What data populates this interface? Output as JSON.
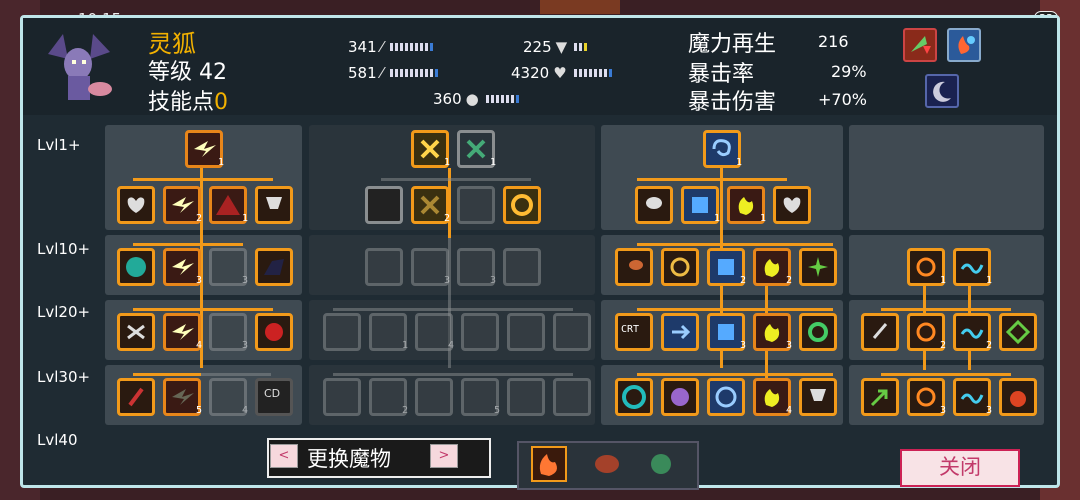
{
  "status": {
    "time": "10:15",
    "badge": "33"
  },
  "character": {
    "name": "灵狐",
    "level_label": "等级 42",
    "skill_points_label": "技能点",
    "skill_points_value": "0"
  },
  "stats": {
    "attack": "341",
    "magic": "581",
    "speed": "360",
    "defense": "225",
    "hp": "4320"
  },
  "regen": {
    "regen_label": "魔力再生",
    "regen_value": "216",
    "crit_rate_label": "暴击率",
    "crit_rate_value": "29%",
    "crit_dmg_label": "暴击伤害",
    "crit_dmg_value": "+70%"
  },
  "levels": [
    "Lvl1+",
    "Lvl10+",
    "Lvl20+",
    "Lvl30+",
    "Lvl40"
  ],
  "buffs": [
    "leaf-up-icon",
    "fire-water-icon",
    "moon-icon"
  ],
  "bottom": {
    "change_monster": "更换魔物",
    "close": "关闭",
    "left_arrow": "<",
    "right_arrow": ">"
  },
  "colors": {
    "accent": "#f29a1a",
    "panel_border": "#bfe6ea",
    "gold_text": "#f2b100"
  },
  "skill_counts": {
    "c1_top": "1",
    "c1_r2b": "2",
    "c1_r2c": "1",
    "c1_r3b": "3",
    "c1_r4b": "4",
    "c1_r5b": "5",
    "c2_top": "1",
    "c2_top2": "1",
    "c2_r2b": "2",
    "c3_top": "1",
    "c3_r2b": "1",
    "c3_r2c": "1",
    "c3_r3c": "2",
    "c3_r3d": "2",
    "c3_r4b": "3",
    "c3_r4c": "3",
    "c3_r5d": "4",
    "c4_r3a": "1",
    "c4_r3b": "1",
    "c4_r4b": "2",
    "c4_r4c": "2",
    "c4_r5b": "3",
    "c4_r5c": "3",
    "c2_r3b": "3",
    "c2_r3c": "3",
    "c2_r4b": "1",
    "c2_r4c": "4",
    "c2_r5b": "2",
    "c2_r5c": "5",
    "c1_r3c": "3",
    "c1_r4c": "3",
    "c1_r5c": "4",
    "c4_r4e": "CO"
  }
}
